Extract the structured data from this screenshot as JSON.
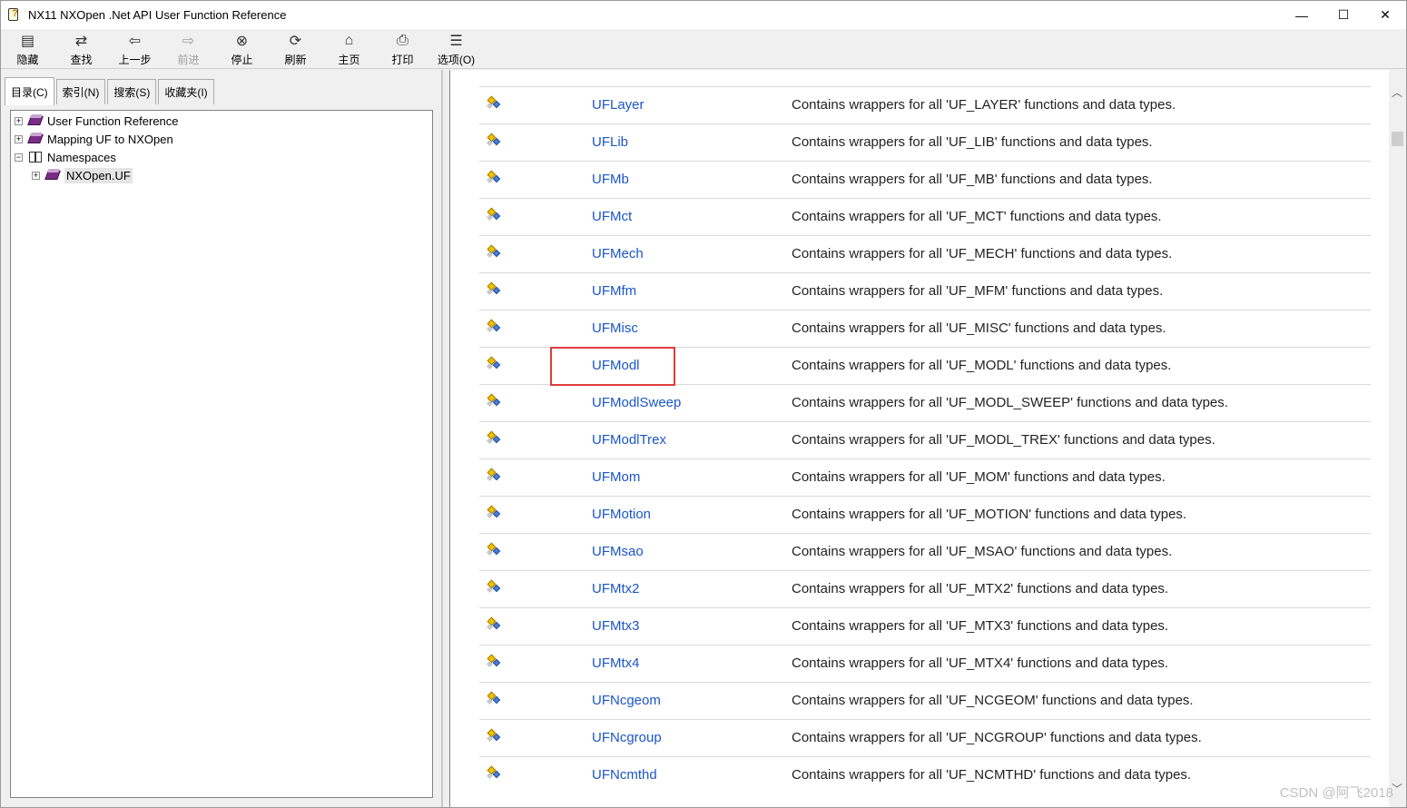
{
  "window": {
    "title": "NX11 NXOpen .Net API User Function Reference",
    "controls": {
      "minimize": "—",
      "maximize": "☐",
      "close": "✕"
    }
  },
  "toolbar": {
    "buttons": [
      {
        "label": "隐藏",
        "icon": "hide-icon",
        "enabled": true
      },
      {
        "label": "查找",
        "icon": "locate-icon",
        "enabled": true
      },
      {
        "label": "上一步",
        "icon": "back-arrow-icon",
        "enabled": true
      },
      {
        "label": "前进",
        "icon": "forward-arrow-icon",
        "enabled": false
      },
      {
        "label": "停止",
        "icon": "stop-icon",
        "enabled": true
      },
      {
        "label": "刷新",
        "icon": "refresh-icon",
        "enabled": true
      },
      {
        "label": "主页",
        "icon": "home-icon",
        "enabled": true
      },
      {
        "label": "打印",
        "icon": "printer-icon",
        "enabled": true
      },
      {
        "label": "选项(O)",
        "icon": "options-icon",
        "enabled": true
      }
    ]
  },
  "left": {
    "tabs": [
      {
        "label": "目录(C)",
        "active": true
      },
      {
        "label": "索引(N)",
        "active": false
      },
      {
        "label": "搜索(S)",
        "active": false
      },
      {
        "label": "收藏夹(I)",
        "active": false
      }
    ],
    "tree": [
      {
        "label": "User Function Reference",
        "expander": "+",
        "icon": "book-icon",
        "level": 0
      },
      {
        "label": "Mapping UF to NXOpen",
        "expander": "+",
        "icon": "book-icon",
        "level": 0
      },
      {
        "label": "Namespaces",
        "expander": "−",
        "icon": "open-book-icon",
        "level": 0
      },
      {
        "label": "NXOpen.UF",
        "expander": "+",
        "icon": "book-icon",
        "level": 1,
        "selected": true
      }
    ]
  },
  "content": {
    "rows": [
      {
        "name": "UFLayer",
        "desc": "Contains wrappers for all 'UF_LAYER' functions and data types."
      },
      {
        "name": "UFLib",
        "desc": "Contains wrappers for all 'UF_LIB' functions and data types."
      },
      {
        "name": "UFMb",
        "desc": "Contains wrappers for all 'UF_MB' functions and data types."
      },
      {
        "name": "UFMct",
        "desc": "Contains wrappers for all 'UF_MCT' functions and data types."
      },
      {
        "name": "UFMech",
        "desc": "Contains wrappers for all 'UF_MECH' functions and data types."
      },
      {
        "name": "UFMfm",
        "desc": "Contains wrappers for all 'UF_MFM' functions and data types."
      },
      {
        "name": "UFMisc",
        "desc": "Contains wrappers for all 'UF_MISC' functions and data types."
      },
      {
        "name": "UFModl",
        "desc": "Contains wrappers for all 'UF_MODL' functions and data types."
      },
      {
        "name": "UFModlSweep",
        "desc": "Contains wrappers for all 'UF_MODL_SWEEP' functions and data types."
      },
      {
        "name": "UFModlTrex",
        "desc": "Contains wrappers for all 'UF_MODL_TREX' functions and data types."
      },
      {
        "name": "UFMom",
        "desc": "Contains wrappers for all 'UF_MOM' functions and data types."
      },
      {
        "name": "UFMotion",
        "desc": "Contains wrappers for all 'UF_MOTION' functions and data types."
      },
      {
        "name": "UFMsao",
        "desc": "Contains wrappers for all 'UF_MSAO' functions and data types."
      },
      {
        "name": "UFMtx2",
        "desc": "Contains wrappers for all 'UF_MTX2' functions and data types."
      },
      {
        "name": "UFMtx3",
        "desc": "Contains wrappers for all 'UF_MTX3' functions and data types."
      },
      {
        "name": "UFMtx4",
        "desc": "Contains wrappers for all 'UF_MTX4' functions and data types."
      },
      {
        "name": "UFNcgeom",
        "desc": "Contains wrappers for all 'UF_NCGEOM' functions and data types."
      },
      {
        "name": "UFNcgroup",
        "desc": "Contains wrappers for all 'UF_NCGROUP' functions and data types."
      },
      {
        "name": "UFNcmthd",
        "desc": "Contains wrappers for all 'UF_NCMTHD' functions and data types."
      }
    ]
  },
  "watermark": "CSDN @阿飞2018",
  "colors": {
    "link": "#1a56c8",
    "highlight": "#e03c3c"
  }
}
